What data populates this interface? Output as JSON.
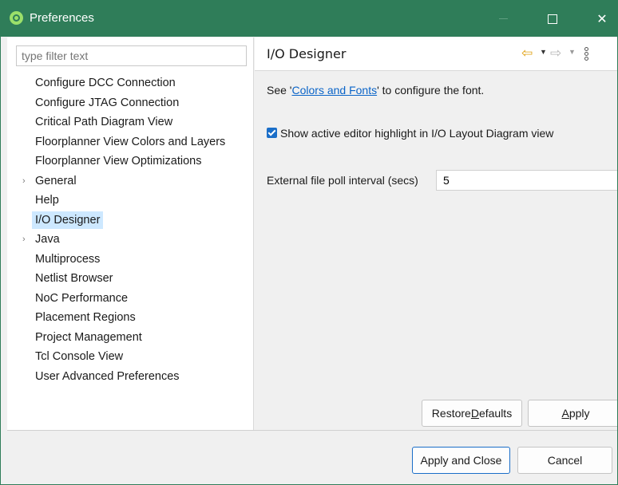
{
  "window": {
    "title": "Preferences",
    "colors": {
      "titlebar": "#2f7d59",
      "accent": "#1a6ec8",
      "selection": "#cde8ff"
    }
  },
  "titlebar_icons": [
    "app-logo-icon",
    "minimize-icon",
    "maximize-icon",
    "close-icon"
  ],
  "filter": {
    "placeholder": "type filter text"
  },
  "tree": {
    "items": [
      {
        "label": "Configure DCC Connection",
        "expandable": false
      },
      {
        "label": "Configure JTAG Connection",
        "expandable": false
      },
      {
        "label": "Critical Path Diagram View",
        "expandable": false
      },
      {
        "label": "Floorplanner View Colors and Layers",
        "expandable": false
      },
      {
        "label": "Floorplanner View Optimizations",
        "expandable": false
      },
      {
        "label": "General",
        "expandable": true
      },
      {
        "label": "Help",
        "expandable": false
      },
      {
        "label": "I/O Designer",
        "expandable": false,
        "selected": true
      },
      {
        "label": "Java",
        "expandable": true
      },
      {
        "label": "Multiprocess",
        "expandable": false
      },
      {
        "label": "Netlist Browser",
        "expandable": false
      },
      {
        "label": "NoC Performance",
        "expandable": false
      },
      {
        "label": "Placement Regions",
        "expandable": false
      },
      {
        "label": "Project Management",
        "expandable": false
      },
      {
        "label": "Tcl Console View",
        "expandable": false
      },
      {
        "label": "User Advanced Preferences",
        "expandable": false
      }
    ],
    "twisty_glyph": "›"
  },
  "page": {
    "title": "I/O Designer",
    "nav_icons": [
      "back-arrow-icon",
      "dropdown-icon",
      "forward-arrow-icon",
      "dropdown-icon",
      "view-menu-icon"
    ],
    "see_prefix": "See '",
    "see_link": "Colors and Fonts",
    "see_suffix": "' to configure the font.",
    "checkbox_label": "Show active editor highlight in I/O Layout Diagram view",
    "checkbox_checked": true,
    "poll_label": "External file poll interval (secs)",
    "poll_value": "5",
    "restore_pre": "Restore ",
    "restore_mn": "D",
    "restore_post": "efaults",
    "apply_mn": "A",
    "apply_post": "pply"
  },
  "footer": {
    "apply_close_label": "Apply and Close",
    "cancel_label": "Cancel"
  }
}
